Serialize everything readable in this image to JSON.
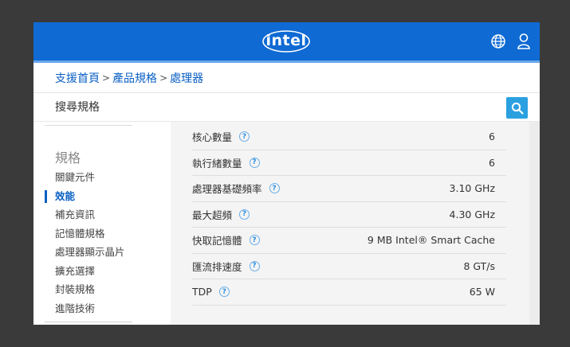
{
  "header": {
    "logo_text": "intel",
    "globe_icon": "globe-icon",
    "user_icon": "user-icon"
  },
  "breadcrumb": {
    "items": [
      "支援首頁",
      "產品規格",
      "處理器"
    ],
    "separator": ">"
  },
  "search": {
    "placeholder": "搜尋規格"
  },
  "sidebar": {
    "title": "規格",
    "items": [
      {
        "label": "關鍵元件"
      },
      {
        "label": "效能",
        "active": true
      },
      {
        "label": "補充資訊"
      },
      {
        "label": "記憶體規格"
      },
      {
        "label": "處理器顯示晶片"
      },
      {
        "label": "擴充選擇"
      },
      {
        "label": "封裝規格"
      },
      {
        "label": "進階技術"
      }
    ]
  },
  "specs": [
    {
      "label": "核心數量",
      "value": "6"
    },
    {
      "label": "執行緒數量",
      "value": "6"
    },
    {
      "label": "處理器基礎頻率",
      "value": "3.10 GHz"
    },
    {
      "label": "最大超頻",
      "value": "4.30 GHz"
    },
    {
      "label": "快取記憶體",
      "value": "9 MB Intel® Smart Cache"
    },
    {
      "label": "匯流排速度",
      "value": "8 GT/s"
    },
    {
      "label": "TDP",
      "value": "65 W"
    }
  ],
  "help_glyph": "?",
  "colors": {
    "header_blue": "#0f6ad3",
    "link_blue": "#0a5fc4",
    "search_button": "#2aa0e0"
  }
}
